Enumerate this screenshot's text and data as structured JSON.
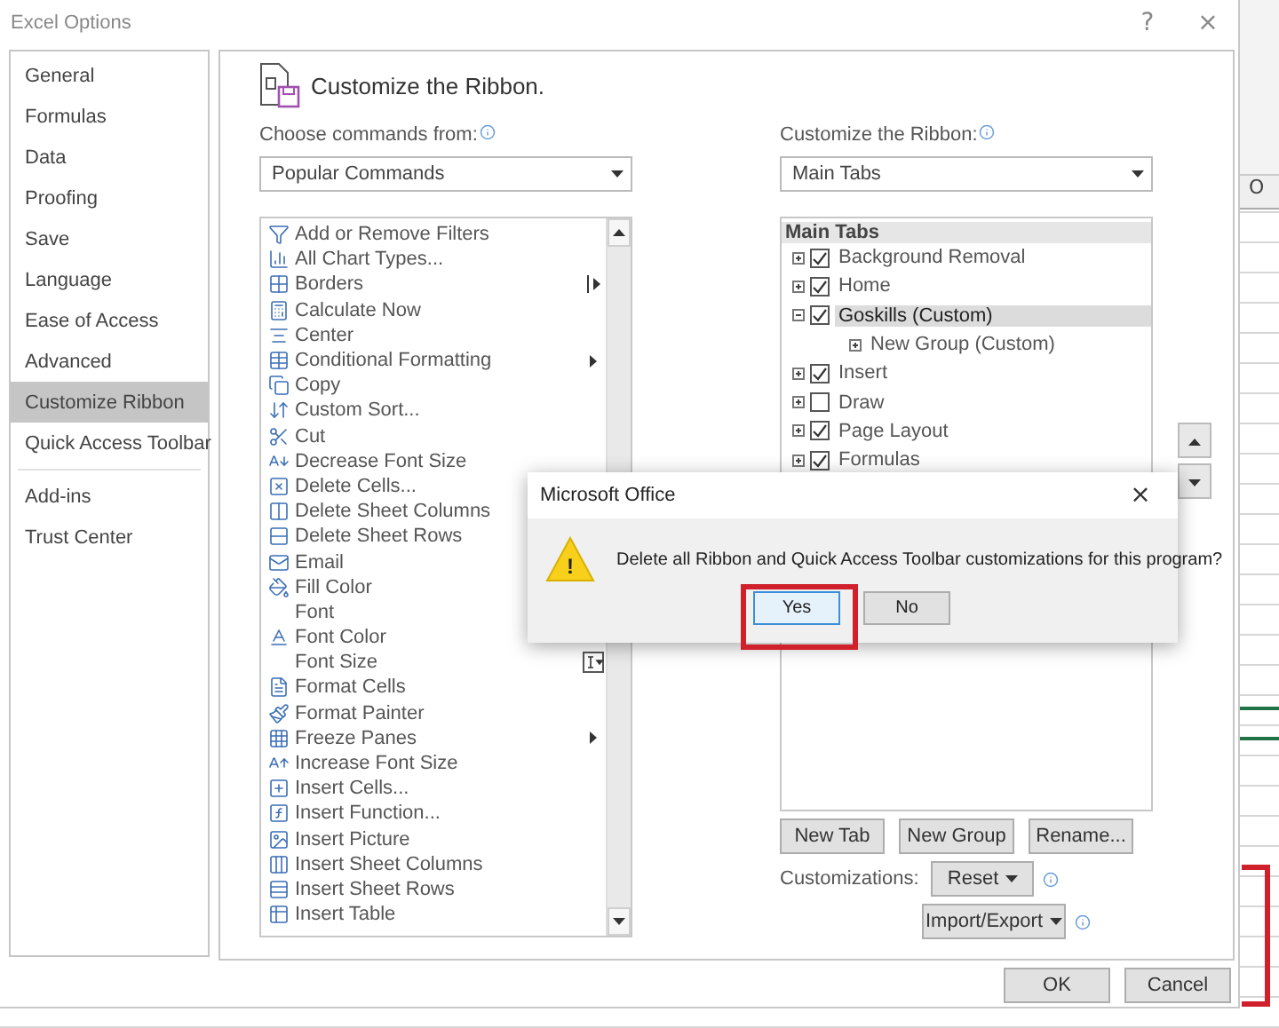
{
  "window": {
    "title": "Excel Options",
    "help": "?",
    "close": "×"
  },
  "sidebar": {
    "items": [
      {
        "label": "General",
        "selected": false
      },
      {
        "label": "Formulas",
        "selected": false
      },
      {
        "label": "Data",
        "selected": false
      },
      {
        "label": "Proofing",
        "selected": false
      },
      {
        "label": "Save",
        "selected": false
      },
      {
        "label": "Language",
        "selected": false
      },
      {
        "label": "Ease of Access",
        "selected": false
      },
      {
        "label": "Advanced",
        "selected": false
      },
      {
        "label": "Customize Ribbon",
        "selected": true
      },
      {
        "label": "Quick Access Toolbar",
        "selected": false
      },
      {
        "label": "Add-ins",
        "selected": false,
        "separator_before": true
      },
      {
        "label": "Trust Center",
        "selected": false
      }
    ]
  },
  "heading": "Customize the Ribbon.",
  "commands": {
    "label": "Choose commands from:",
    "value": "Popular Commands",
    "items": [
      {
        "label": "Add or Remove Filters",
        "kind": "plain"
      },
      {
        "label": "All Chart Types...",
        "kind": "plain"
      },
      {
        "label": "Borders",
        "kind": "split"
      },
      {
        "label": "Calculate Now",
        "kind": "plain"
      },
      {
        "label": "Center",
        "kind": "plain"
      },
      {
        "label": "Conditional Formatting",
        "kind": "submenu"
      },
      {
        "label": "Copy",
        "kind": "plain"
      },
      {
        "label": "Custom Sort...",
        "kind": "plain"
      },
      {
        "label": "Cut",
        "kind": "plain"
      },
      {
        "label": "Decrease Font Size",
        "kind": "plain"
      },
      {
        "label": "Delete Cells...",
        "kind": "plain"
      },
      {
        "label": "Delete Sheet Columns",
        "kind": "plain"
      },
      {
        "label": "Delete Sheet Rows",
        "kind": "plain"
      },
      {
        "label": "Email",
        "kind": "plain"
      },
      {
        "label": "Fill Color",
        "kind": "plain"
      },
      {
        "label": "Font",
        "kind": "plain"
      },
      {
        "label": "Font Color",
        "kind": "plain"
      },
      {
        "label": "Font Size",
        "kind": "combo"
      },
      {
        "label": "Format Cells",
        "kind": "plain"
      },
      {
        "label": "Format Painter",
        "kind": "plain"
      },
      {
        "label": "Freeze Panes",
        "kind": "submenu"
      },
      {
        "label": "Increase Font Size",
        "kind": "plain"
      },
      {
        "label": "Insert Cells...",
        "kind": "plain"
      },
      {
        "label": "Insert Function...",
        "kind": "plain"
      },
      {
        "label": "Insert Picture",
        "kind": "plain"
      },
      {
        "label": "Insert Sheet Columns",
        "kind": "plain"
      },
      {
        "label": "Insert Sheet Rows",
        "kind": "plain"
      },
      {
        "label": "Insert Table",
        "kind": "plain"
      }
    ]
  },
  "ribbon": {
    "label": "Customize the Ribbon:",
    "value": "Main Tabs",
    "tree_header": "Main Tabs",
    "items": [
      {
        "label": "Background Removal",
        "checked": true,
        "expanded": false,
        "selected": false
      },
      {
        "label": "Home",
        "checked": true,
        "expanded": false,
        "selected": false
      },
      {
        "label": "Goskills (Custom)",
        "checked": true,
        "expanded": true,
        "selected": true,
        "children": [
          {
            "label": "New Group (Custom)",
            "expanded": false
          }
        ]
      },
      {
        "label": "Insert",
        "checked": true,
        "expanded": false,
        "selected": false
      },
      {
        "label": "Draw",
        "checked": false,
        "expanded": false,
        "selected": false
      },
      {
        "label": "Page Layout",
        "checked": true,
        "expanded": false,
        "selected": false
      },
      {
        "label": "Formulas",
        "checked": true,
        "expanded": false,
        "selected": false
      }
    ],
    "buttons": [
      "New Tab",
      "New Group",
      "Rename..."
    ],
    "customizations_label": "Customizations:",
    "reset": "Reset",
    "import_export": "Import/Export"
  },
  "footer": {
    "ok": "OK",
    "cancel": "Cancel"
  },
  "sheet": {
    "column_header": "O"
  },
  "alert": {
    "title": "Microsoft Office",
    "close": "×",
    "icon_mark": "!",
    "message": "Delete all Ribbon and Quick Access Toolbar customizations for this program?",
    "buttons": [
      {
        "label": "Yes",
        "selected": true
      },
      {
        "label": "No",
        "selected": false
      }
    ]
  }
}
